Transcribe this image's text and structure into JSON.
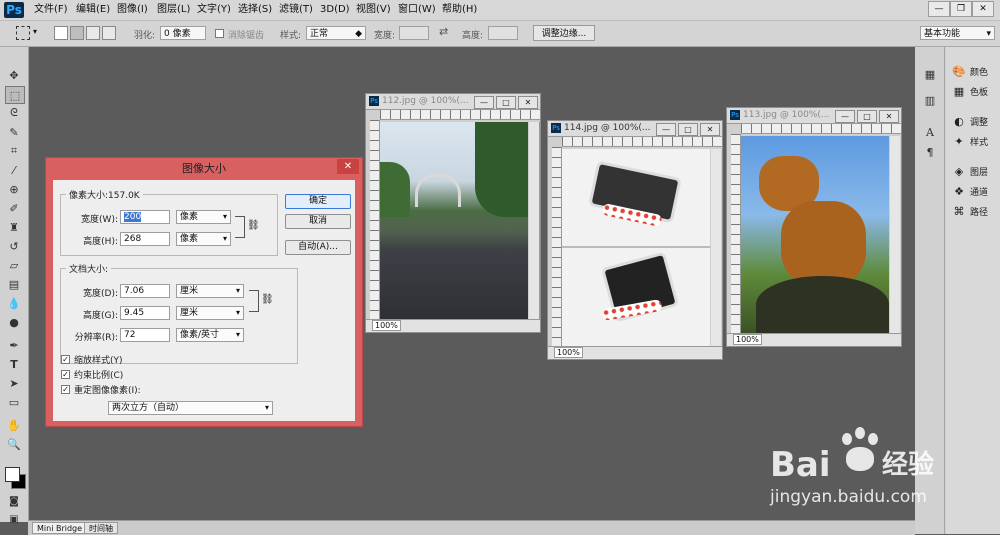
{
  "app": {
    "logo": "Ps"
  },
  "menu": [
    "文件(F)",
    "编辑(E)",
    "图像(I)",
    "图层(L)",
    "文字(Y)",
    "选择(S)",
    "滤镜(T)",
    "3D(D)",
    "视图(V)",
    "窗口(W)",
    "帮助(H)"
  ],
  "window_controls": {
    "minimize": "—",
    "restore": "❐",
    "close": "✕"
  },
  "options": {
    "feather_label": "羽化:",
    "feather_value": "0 像素",
    "antialias_label": "消除锯齿",
    "style_label": "样式:",
    "style_value": "正常",
    "width_label": "宽度:",
    "height_label": "高度:",
    "refine_button": "调整边缘...",
    "workspace": "基本功能"
  },
  "documents": [
    {
      "title": "112.jpg @ 100%(...",
      "zoom": "100%"
    },
    {
      "title": "114.jpg @ 100%(...",
      "zoom": "100%"
    },
    {
      "title": "113.jpg @ 100%(...",
      "zoom": "100%"
    }
  ],
  "dialog": {
    "title": "图像大小",
    "close": "✕",
    "pixel_dimensions_title": "像素大小:157.0K",
    "px_width_label": "宽度(W):",
    "px_width_value": "200",
    "px_width_unit": "像素",
    "px_height_label": "高度(H):",
    "px_height_value": "268",
    "px_height_unit": "像素",
    "doc_size_title": "文档大小:",
    "doc_width_label": "宽度(D):",
    "doc_width_value": "7.06",
    "doc_width_unit": "厘米",
    "doc_height_label": "高度(G):",
    "doc_height_value": "9.45",
    "doc_height_unit": "厘米",
    "resolution_label": "分辨率(R):",
    "resolution_value": "72",
    "resolution_unit": "像素/英寸",
    "scale_styles": "缩放样式(Y)",
    "constrain": "约束比例(C)",
    "resample": "重定图像像素(I):",
    "resample_method": "两次立方（自动）",
    "ok": "确定",
    "cancel": "取消",
    "auto": "自动(A)..."
  },
  "panels": [
    {
      "icon": "palette-icon",
      "label": "颜色"
    },
    {
      "icon": "swatches-icon",
      "label": "色板"
    },
    {
      "icon": "adjustments-icon",
      "label": "调整"
    },
    {
      "icon": "styles-icon",
      "label": "样式"
    },
    {
      "icon": "layers-icon",
      "label": "图层"
    },
    {
      "icon": "channels-icon",
      "label": "通道"
    },
    {
      "icon": "paths-icon",
      "label": "路径"
    }
  ],
  "bottom_tabs": [
    "Mini Bridge",
    "时间轴"
  ],
  "watermark": {
    "brand": "Bai",
    "brand2": "经验",
    "url": "jingyan.baidu.com"
  }
}
